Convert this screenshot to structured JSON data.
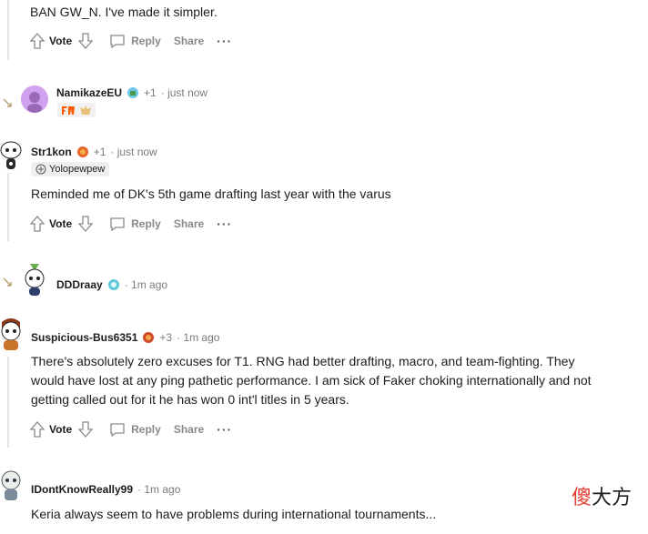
{
  "top_comment": {
    "body": "BAN GW_N. I've made it simpler.",
    "actions": {
      "vote": "Vote",
      "reply": "Reply",
      "share": "Share",
      "more": "···"
    }
  },
  "comments": [
    {
      "username": "NamikazeEU",
      "karma": "+1",
      "time": "· just now",
      "flair_icons": [
        "fnatic-logo-icon",
        "crown-flair-icon"
      ]
    },
    {
      "username": "Str1kon",
      "karma": "+1",
      "time": "· just now",
      "user_flair": "Yolopewpew",
      "body": "Reminded me of DK's 5th game drafting last year with the varus",
      "actions": {
        "vote": "Vote",
        "reply": "Reply",
        "share": "Share",
        "more": "···"
      }
    },
    {
      "username": "DDDraay",
      "time": "· 1m ago"
    },
    {
      "username": "Suspicious-Bus6351",
      "karma": "+3",
      "time": "· 1m ago",
      "body_lines": [
        "There's absolutely zero excuses for T1. RNG had better drafting, macro, and team-fighting. They",
        "would have lost at any ping pathetic performance. I am sick of Faker choking internationally and not",
        "getting called out for it he has won 0 int'l titles in 5 years."
      ],
      "actions": {
        "vote": "Vote",
        "reply": "Reply",
        "share": "Share",
        "more": "···"
      }
    },
    {
      "username": "IDontKnowReally99",
      "time": "· 1m ago",
      "body": "Keria always seem to have problems during international tournaments..."
    }
  ],
  "watermark": {
    "red": "傻",
    "rest": "大方"
  },
  "colors": {
    "accent": "#0079d3",
    "muted": "#878a8c",
    "text": "#1c1c1c"
  }
}
